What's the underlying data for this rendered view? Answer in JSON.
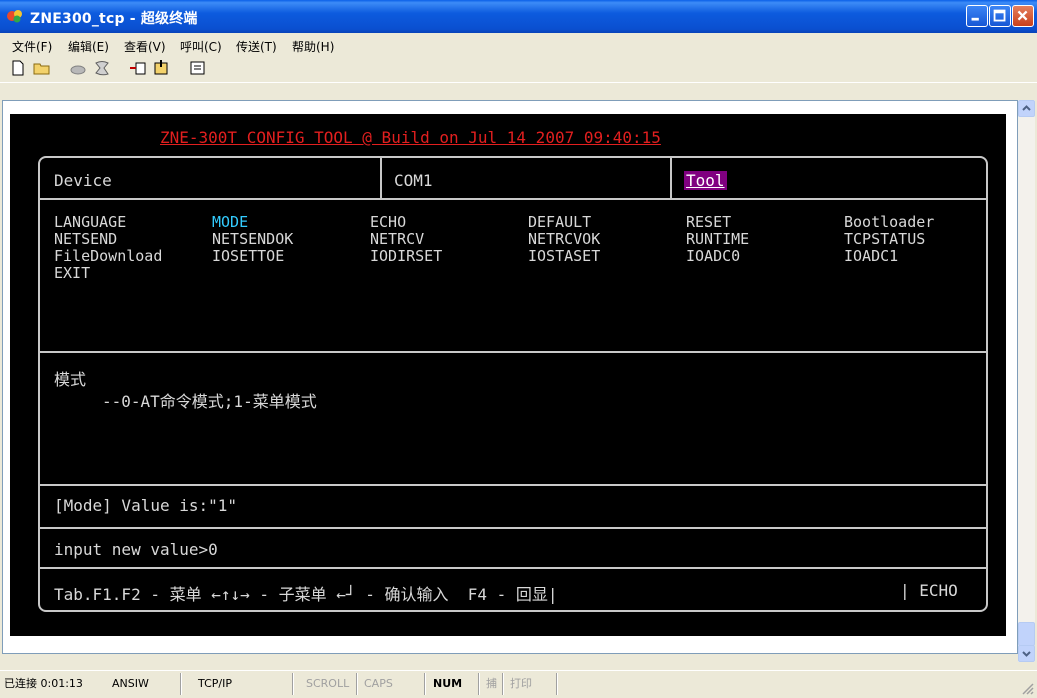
{
  "window": {
    "title": "ZNE300_tcp - 超级终端"
  },
  "menu": [
    "文件(F)",
    "编辑(E)",
    "查看(V)",
    "呼叫(C)",
    "传送(T)",
    "帮助(H)"
  ],
  "toolbar": {
    "icons": [
      "new-file-icon",
      "open-folder-icon",
      "phone-icon",
      "disconnect-icon",
      "send-icon",
      "receive-icon",
      "properties-icon"
    ]
  },
  "terminal": {
    "header": "ZNE-300T CONFIG TOOL @ Build on Jul 14 2007 09:40:15",
    "tabs": {
      "device": "Device",
      "com": "COM1",
      "tool": "Tool"
    },
    "tool_items": [
      [
        "LANGUAGE",
        "MODE",
        "ECHO",
        "DEFAULT",
        "RESET",
        "Bootloader"
      ],
      [
        "NETSEND",
        "NETSENDOK",
        "NETRCV",
        "NETRCVOK",
        "RUNTIME",
        "TCPSTATUS"
      ],
      [
        "FileDownload",
        "IOSETTOE",
        "IODIRSET",
        "IOSTASET",
        "IOADC0",
        "IOADC1"
      ],
      [
        "EXIT"
      ]
    ],
    "selected_item": "MODE",
    "desc_title": "模式",
    "desc_body": "--0-AT命令模式;1-菜单模式",
    "value_line": "[Mode] Value is:\"1\"",
    "input_line": "input new value>0",
    "help_line": "Tab.F1.F2 - 菜单 ←↑↓→ - 子菜单 ←┘ - 确认输入  F4 - 回显|",
    "echo_label": "| ECHO"
  },
  "status": {
    "connection": "已连接 0:01:13",
    "emulation": "ANSIW",
    "protocol": "TCP/IP",
    "scroll": "SCROLL",
    "caps": "CAPS",
    "num": "NUM",
    "capture": "捕",
    "print": "打印"
  },
  "colors": {
    "accent_selected": "#33CCFF",
    "tab_active_bg": "#800080",
    "header_red": "#E21F1F"
  }
}
